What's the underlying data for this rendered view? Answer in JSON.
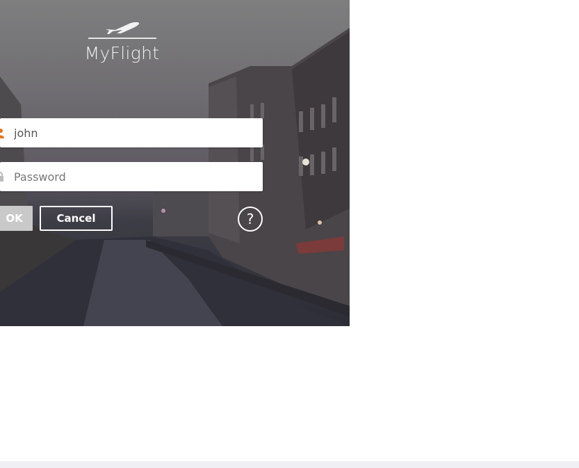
{
  "app": {
    "name": "MyFlight"
  },
  "login": {
    "username_value": "john",
    "password_placeholder": "Password",
    "ok_label": "OK",
    "cancel_label": "Cancel",
    "help_label": "?"
  },
  "icons": {
    "logo": "airplane-icon",
    "username": "user-icon",
    "password": "lock-icon",
    "help": "help-icon"
  },
  "colors": {
    "field_background": "#ffffff",
    "ok_button": "#c9c9c9",
    "button_text": "#ffffff",
    "user_icon_accent": "#e8731f"
  }
}
